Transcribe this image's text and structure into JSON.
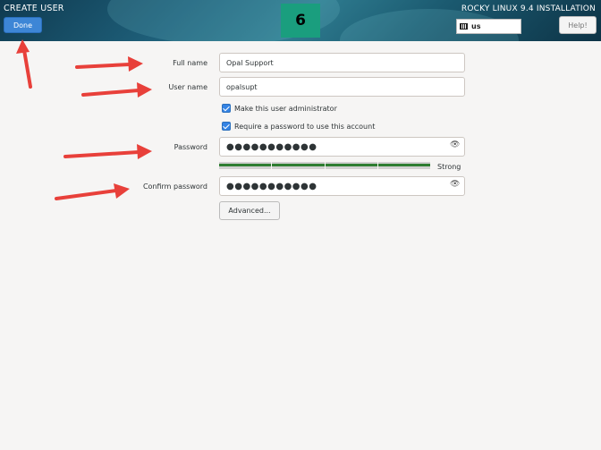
{
  "header": {
    "left_title": "CREATE USER",
    "done_label": "Done",
    "step_number": "6",
    "right_title": "ROCKY LINUX 9.4 INSTALLATION",
    "keyboard_layout": "us",
    "help_label": "Help!"
  },
  "form": {
    "fullname_label": "Full name",
    "fullname_value": "Opal Support",
    "username_label": "User name",
    "username_value": "opalsupt",
    "admin_label": "Make this user administrator",
    "admin_checked": true,
    "require_pw_label": "Require a password to use this account",
    "require_pw_checked": true,
    "password_label": "Password",
    "password_value": "●●●●●●●●●●●",
    "strength_label": "Strong",
    "confirm_label": "Confirm password",
    "confirm_value": "●●●●●●●●●●●",
    "advanced_label": "Advanced..."
  },
  "colors": {
    "accent": "#3584e4",
    "badge": "#1a9e7e",
    "annotation_arrow": "#e8403a",
    "strength_bar": "#2e7d32"
  }
}
